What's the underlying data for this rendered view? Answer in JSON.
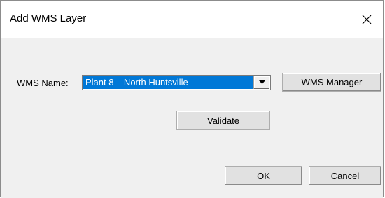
{
  "window": {
    "title": "Add WMS Layer"
  },
  "icons": {
    "close": "close-icon",
    "dropdown": "chevron-down-icon"
  },
  "form": {
    "wms_name_label": "WMS Name:",
    "wms_name_selected": "Plant 8 – North Huntsville"
  },
  "buttons": {
    "wms_manager": "WMS Manager",
    "validate": "Validate",
    "ok": "OK",
    "cancel": "Cancel"
  },
  "colors": {
    "selection": "#0078d7",
    "dialog_background": "#f0f0f0",
    "titlebar_background": "#ffffff"
  }
}
